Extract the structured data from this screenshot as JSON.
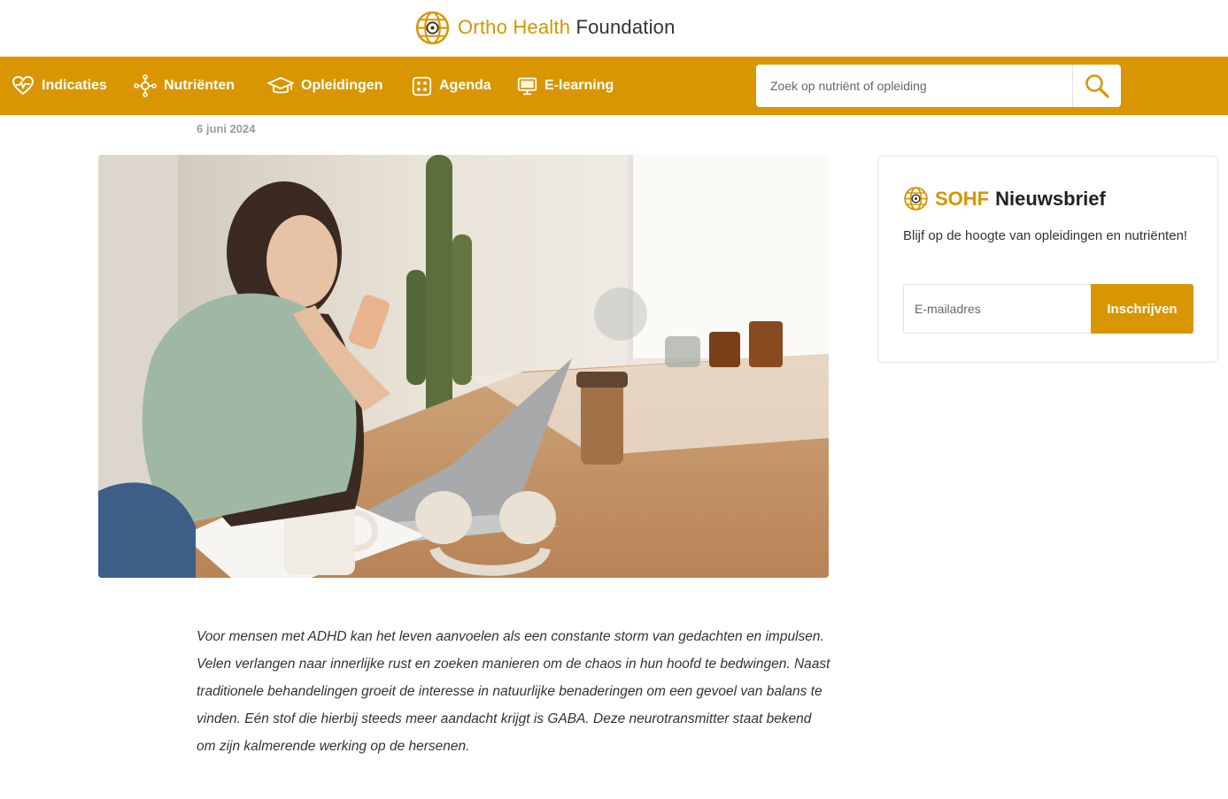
{
  "brand": {
    "name_accent": "Ortho Health",
    "name_rest": "Foundation",
    "accent_color": "#d99602"
  },
  "nav": {
    "items": [
      {
        "label": "Indicaties",
        "icon": "heart-pulse-icon"
      },
      {
        "label": "Nutriënten",
        "icon": "molecule-icon"
      },
      {
        "label": "Opleidingen",
        "icon": "graduation-cap-icon"
      },
      {
        "label": "Agenda",
        "icon": "calendar-grid-icon"
      },
      {
        "label": "E-learning",
        "icon": "monitor-icon"
      }
    ],
    "search": {
      "placeholder": "Zoek op nutriënt of opleiding",
      "button_icon": "search-icon"
    }
  },
  "article": {
    "date": "6 juni 2024",
    "intro": "Voor mensen met ADHD kan het leven aanvoelen als een constante storm van gedachten en impulsen. Velen verlangen naar innerlijke rust en zoeken manieren om de chaos in hun hoofd te bedwingen. Naast traditionele behandelingen groeit de interesse in natuurlijke benaderingen om een gevoel van balans te vinden. Eén stof die hierbij steeds meer aandacht krijgt is GABA. Deze neurotransmitter staat bekend om zijn kalmerende werking op de hersenen."
  },
  "newsletter": {
    "title_accent": "SOHF",
    "title_rest": "Nieuwsbrief",
    "text": "Blijf op de hoogte van opleidingen en nutriënten!",
    "email_placeholder": "E-mailadres",
    "button": "Inschrijven"
  }
}
